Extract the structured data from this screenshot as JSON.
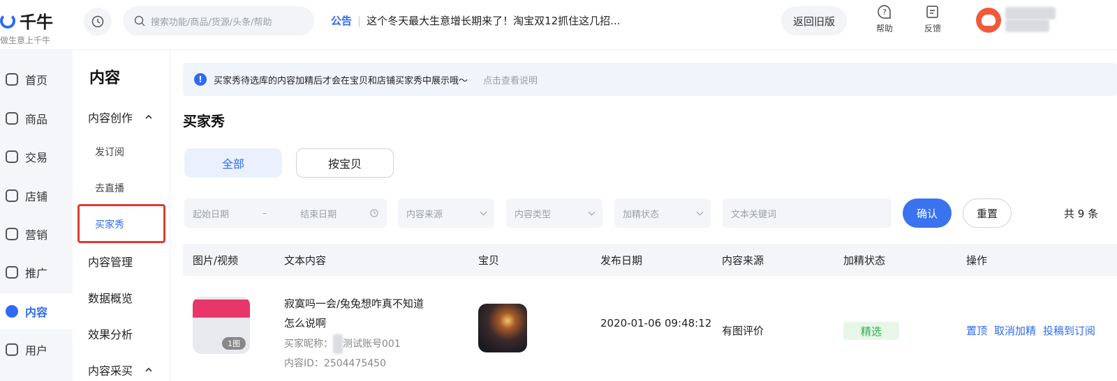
{
  "header": {
    "brand": "千牛",
    "slogan": "做生意上千牛",
    "search_placeholder": "搜索功能/商品/货源/头条/帮助",
    "notice_tag": "公告",
    "notice_sep": "|",
    "notice_text": "这个冬天最大生意增长期来了！淘宝双12抓住这几招...",
    "old_version_label": "返回旧版",
    "help_label": "帮助",
    "feedback_label": "反馈"
  },
  "leftnav": {
    "items": [
      {
        "label": "首页",
        "icon": "home-icon"
      },
      {
        "label": "商品",
        "icon": "bag-icon"
      },
      {
        "label": "交易",
        "icon": "clipboard-icon"
      },
      {
        "label": "店铺",
        "icon": "store-icon"
      },
      {
        "label": "营销",
        "icon": "megaphone-icon"
      },
      {
        "label": "推广",
        "icon": "location-icon"
      },
      {
        "label": "内容",
        "icon": "hash-icon",
        "active": true
      },
      {
        "label": "用户",
        "icon": "user-icon"
      }
    ]
  },
  "subnav": {
    "title": "内容",
    "group_creation": "内容创作",
    "item_subscribe": "发订阅",
    "item_live": "去直播",
    "item_buyer_show": "买家秀",
    "group_manage": "内容管理",
    "group_overview": "数据概览",
    "group_analysis": "效果分析",
    "group_collect": "内容采买"
  },
  "main": {
    "tip_icon": "!",
    "tip_text": "买家秀待选库的内容加精后才会在宝贝和店铺买家秀中展示哦～",
    "tip_link": "点击查看说明",
    "title": "买家秀",
    "tab_all": "全部",
    "tab_by_item": "按宝贝",
    "filter_start": "起始日期",
    "filter_dash": "–",
    "filter_end": "结束日期",
    "filter_source": "内容来源",
    "filter_type": "内容类型",
    "filter_status": "加精状态",
    "filter_keyword": "文本关键词",
    "confirm_label": "确认",
    "reset_label": "重置",
    "total_text": "共 9 条",
    "columns": [
      "图片/视频",
      "文本内容",
      "宝贝",
      "发布日期",
      "内容来源",
      "加精状态",
      "操作"
    ],
    "row": {
      "thumb_badge": "1图",
      "text_line1": "寂寞吗一会/兔兔想咋真不知道",
      "text_line2": "怎么说啊",
      "nickname_label": "买家昵称：",
      "nickname_value": "测试账号001",
      "content_id_label": "内容ID：",
      "content_id_value": "2504475450",
      "date": "2020-01-06 09:48:12",
      "source": "有图评价",
      "status": "精选",
      "op_pin": "置顶",
      "op_unfeature": "取消加精",
      "op_submit": "投稿到订阅"
    }
  },
  "colors": {
    "accent": "#2f6bf2",
    "highlight_border": "#e03a2f",
    "status_green": "#2fae4e"
  }
}
